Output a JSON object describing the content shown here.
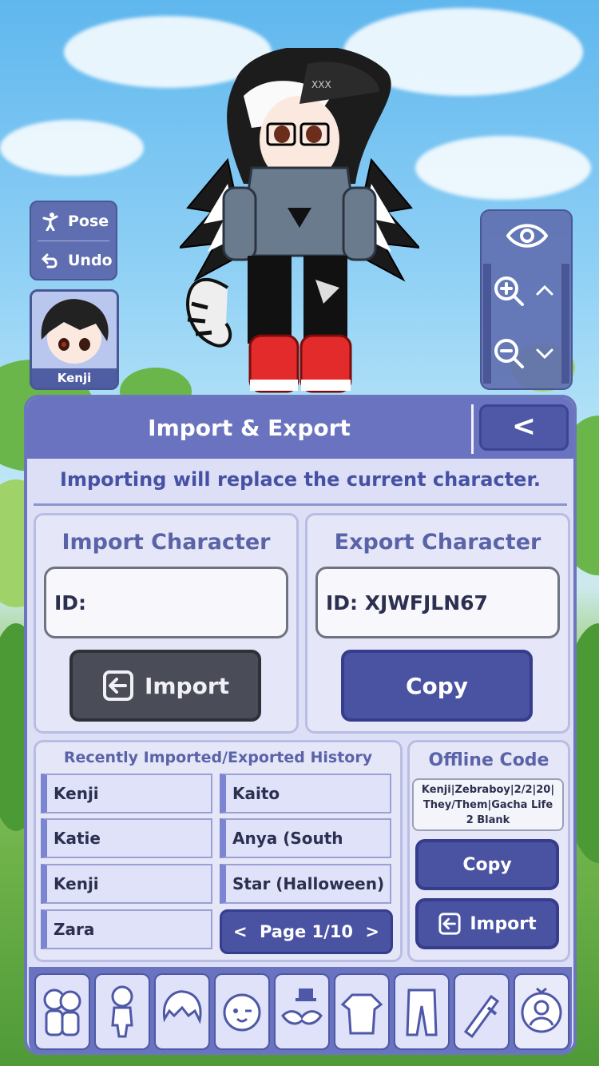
{
  "controls": {
    "pose_label": "Pose",
    "undo_label": "Undo",
    "character_name": "Kenji"
  },
  "panel": {
    "title": "Import & Export",
    "back_label": "<",
    "warning": "Importing will replace the current character.",
    "import": {
      "title": "Import Character",
      "id_value": "ID:",
      "button_label": "Import"
    },
    "export": {
      "title": "Export Character",
      "id_value": "ID: XJWFJLN67",
      "button_label": "Copy"
    },
    "history": {
      "title": "Recently Imported/Exported History",
      "items": [
        "Kenji",
        "Kaito",
        "Katie",
        "Anya (South",
        "Kenji",
        "Star (Halloween)",
        "Zara"
      ],
      "page_label": "Page 1/10",
      "prev_label": "<",
      "next_label": ">"
    },
    "offline": {
      "title": "Offline Code",
      "code": "Kenji|Zebraboy|2/2|20|They/Them|Gacha Life 2 Blank",
      "copy_label": "Copy",
      "import_label": "Import"
    }
  },
  "categories": [
    "presets-icon",
    "body-icon",
    "hair-icon",
    "face-icon",
    "accessories-icon",
    "top-icon",
    "bottom-icon",
    "props-icon",
    "profile-icon"
  ],
  "colors": {
    "panel_header": "#6a73bf",
    "panel_bg": "#dcdff6",
    "button_blue": "#4a52a2",
    "button_dark": "#4a4c57"
  }
}
